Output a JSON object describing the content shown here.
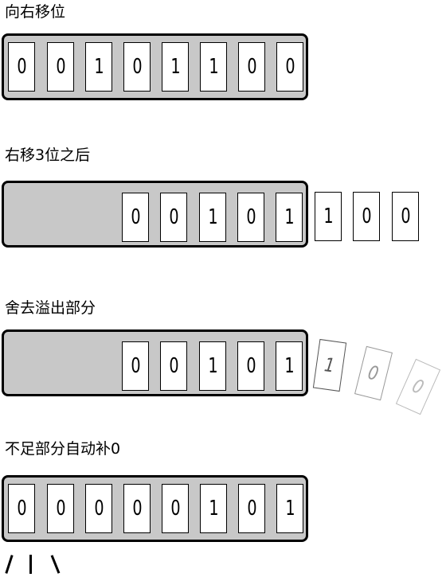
{
  "sections": [
    {
      "label": "向右移位",
      "bits": [
        "0",
        "0",
        "1",
        "0",
        "1",
        "1",
        "0",
        "0"
      ]
    },
    {
      "label": "右移3位之后",
      "bits": [
        "0",
        "0",
        "1",
        "0",
        "1"
      ],
      "outside_bits": [
        "1",
        "0",
        "0"
      ]
    },
    {
      "label": "舍去溢出部分",
      "bits": [
        "0",
        "0",
        "1",
        "0",
        "1"
      ],
      "discarded_bits": [
        "1",
        "0",
        "0"
      ]
    },
    {
      "label": "不足部分自动补0",
      "bits": [
        "0",
        "0",
        "0",
        "0",
        "0",
        "1",
        "0",
        "1"
      ]
    }
  ]
}
